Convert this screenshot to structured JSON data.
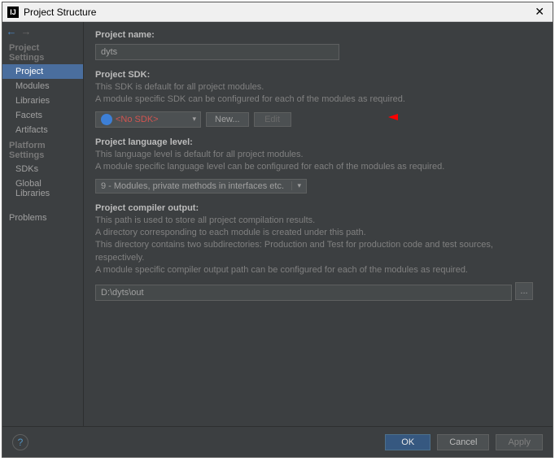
{
  "window": {
    "title": "Project Structure"
  },
  "sidebar": {
    "sections": {
      "project_settings": {
        "header": "Project Settings",
        "items": [
          "Project",
          "Modules",
          "Libraries",
          "Facets",
          "Artifacts"
        ]
      },
      "platform_settings": {
        "header": "Platform Settings",
        "items": [
          "SDKs",
          "Global Libraries"
        ]
      },
      "problems": {
        "items": [
          "Problems"
        ]
      }
    }
  },
  "content": {
    "project_name": {
      "label": "Project name:",
      "value": "dyts"
    },
    "project_sdk": {
      "label": "Project SDK:",
      "desc1": "This SDK is default for all project modules.",
      "desc2": "A module specific SDK can be configured for each of the modules as required.",
      "selected": "<No SDK>",
      "new_btn": "New...",
      "edit_btn": "Edit"
    },
    "language_level": {
      "label": "Project language level:",
      "desc1": "This language level is default for all project modules.",
      "desc2": "A module specific language level can be configured for each of the modules as required.",
      "selected": "9 - Modules, private methods in interfaces etc."
    },
    "compiler_output": {
      "label": "Project compiler output:",
      "desc1": "This path is used to store all project compilation results.",
      "desc2": "A directory corresponding to each module is created under this path.",
      "desc3": "This directory contains two subdirectories: Production and Test for production code and test sources, respectively.",
      "desc4": "A module specific compiler output path can be configured for each of the modules as required.",
      "value": "D:\\dyts\\out"
    }
  },
  "footer": {
    "ok": "OK",
    "cancel": "Cancel",
    "apply": "Apply"
  }
}
